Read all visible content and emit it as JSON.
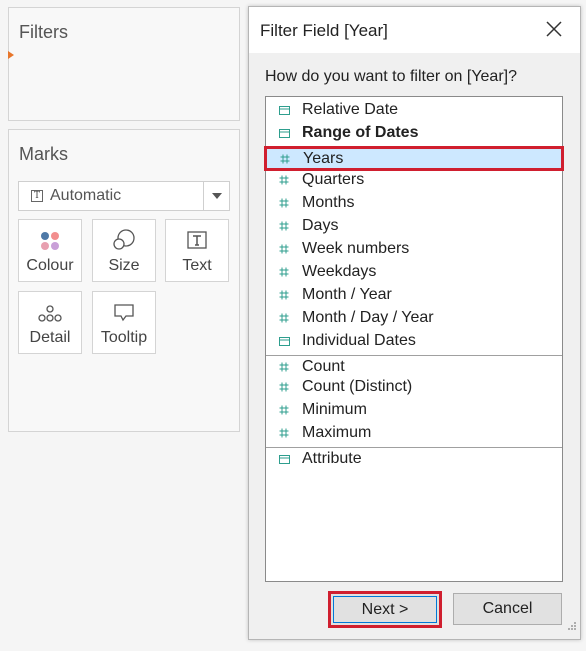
{
  "filters_pane": {
    "title": "Filters"
  },
  "marks_pane": {
    "title": "Marks",
    "mark_type": "Automatic",
    "buttons": [
      {
        "label": "Colour",
        "icon": "colour-dots-icon"
      },
      {
        "label": "Size",
        "icon": "size-circles-icon"
      },
      {
        "label": "Text",
        "icon": "text-t-icon"
      },
      {
        "label": "Detail",
        "icon": "detail-dots-icon"
      },
      {
        "label": "Tooltip",
        "icon": "tooltip-bubble-icon"
      }
    ]
  },
  "dialog": {
    "title": "Filter Field [Year]",
    "question": "How do you want to filter on [Year]?",
    "items": [
      {
        "label": "Relative Date",
        "icon": "calendar-icon"
      },
      {
        "label": "Range of Dates",
        "icon": "calendar-icon"
      },
      {
        "label": "Years",
        "icon": "hash-icon"
      },
      {
        "label": "Quarters",
        "icon": "hash-icon"
      },
      {
        "label": "Months",
        "icon": "hash-icon"
      },
      {
        "label": "Days",
        "icon": "hash-icon"
      },
      {
        "label": "Week numbers",
        "icon": "hash-icon"
      },
      {
        "label": "Weekdays",
        "icon": "hash-icon"
      },
      {
        "label": "Month / Year",
        "icon": "hash-icon"
      },
      {
        "label": "Month / Day / Year",
        "icon": "hash-icon"
      },
      {
        "label": "Individual Dates",
        "icon": "calendar-icon"
      },
      {
        "label": "Count",
        "icon": "hash-icon"
      },
      {
        "label": "Count (Distinct)",
        "icon": "hash-icon"
      },
      {
        "label": "Minimum",
        "icon": "hash-icon"
      },
      {
        "label": "Maximum",
        "icon": "hash-icon"
      },
      {
        "label": "Attribute",
        "icon": "calendar-icon"
      }
    ],
    "selected_item": "Years",
    "next_label": "Next >",
    "cancel_label": "Cancel"
  },
  "colors": {
    "highlight_red": "#d01f2f",
    "selection_blue": "#cde8ff",
    "icon_teal": "#2e9e8e",
    "filters_marker": "#e8762b"
  }
}
